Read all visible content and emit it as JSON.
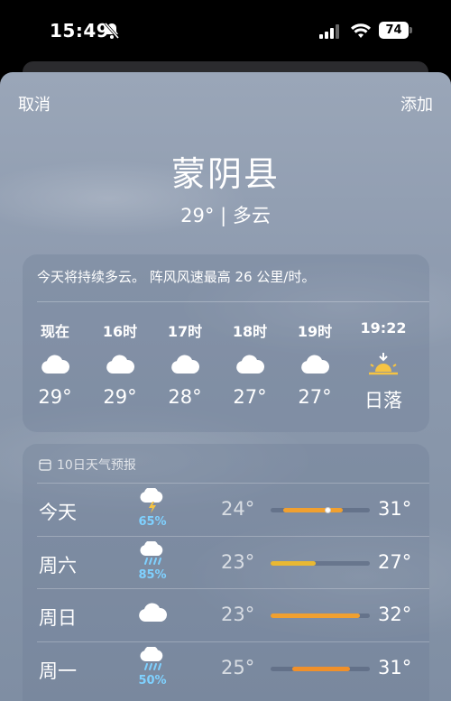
{
  "status_bar": {
    "time": "15:49",
    "battery": "74"
  },
  "nav": {
    "cancel": "取消",
    "add": "添加"
  },
  "location": {
    "city": "蒙阴县",
    "subtitle": "29° | 多云"
  },
  "hourly": {
    "summary": "今天将持续多云。 阵风风速最高 26 公里/时。",
    "items": [
      {
        "label": "现在",
        "icon": "cloud-icon",
        "value": "29°"
      },
      {
        "label": "16时",
        "icon": "cloud-icon",
        "value": "29°"
      },
      {
        "label": "17时",
        "icon": "cloud-icon",
        "value": "28°"
      },
      {
        "label": "18时",
        "icon": "cloud-icon",
        "value": "27°"
      },
      {
        "label": "19时",
        "icon": "cloud-icon",
        "value": "27°"
      },
      {
        "label": "19:22",
        "icon": "sunset-icon",
        "value": "日落"
      }
    ]
  },
  "daily": {
    "header": "10日天气预报",
    "days": [
      {
        "day": "今天",
        "icon": "thunderstorm-icon",
        "precip": "65%",
        "low": "24°",
        "high": "31°",
        "bar_start": 0.13,
        "bar_end": 0.73,
        "current": 0.58,
        "bar_color": "#f0a030"
      },
      {
        "day": "周六",
        "icon": "rain-icon",
        "precip": "85%",
        "low": "23°",
        "high": "27°",
        "bar_start": 0.0,
        "bar_end": 0.45,
        "bar_color": "#e9b832"
      },
      {
        "day": "周日",
        "icon": "cloud-icon",
        "precip": "",
        "low": "23°",
        "high": "32°",
        "bar_start": 0.0,
        "bar_end": 0.9,
        "bar_color": "#f0a030"
      },
      {
        "day": "周一",
        "icon": "rain-icon",
        "precip": "50%",
        "low": "25°",
        "high": "31°",
        "bar_start": 0.22,
        "bar_end": 0.8,
        "bar_color": "#f0902a"
      }
    ]
  }
}
